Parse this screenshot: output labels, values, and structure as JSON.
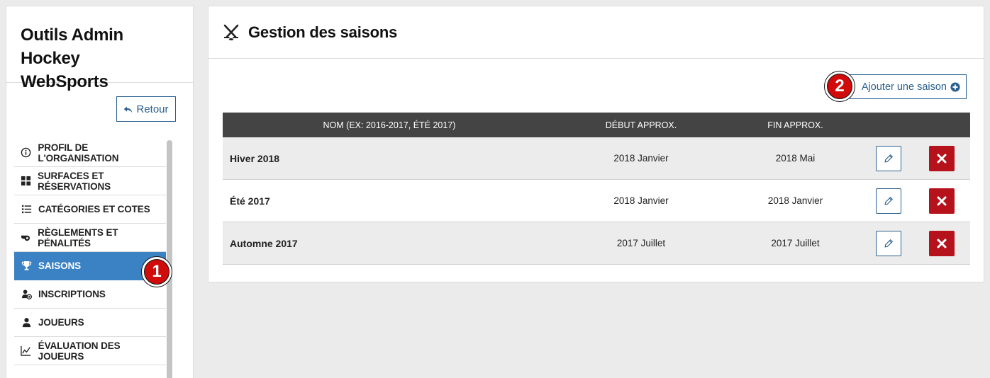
{
  "sidebar": {
    "title_line1": "Outils Admin Hockey",
    "title_line2": "WebSports",
    "back_label": "Retour",
    "back_icon": "reply-icon",
    "items": [
      {
        "label": "Profil de l'organisation",
        "icon": "info-circle-icon"
      },
      {
        "label": "Surfaces et réservations",
        "icon": "grid-icon"
      },
      {
        "label": "Catégories et cotes",
        "icon": "list-icon"
      },
      {
        "label": "Règlements et pénalités",
        "icon": "whistle-icon"
      },
      {
        "label": "Saisons",
        "icon": "trophy-icon",
        "active": true
      },
      {
        "label": "Inscriptions",
        "icon": "user-add-icon"
      },
      {
        "label": "Joueurs",
        "icon": "user-icon"
      },
      {
        "label": "Évaluation des joueurs",
        "icon": "line-chart-icon"
      }
    ]
  },
  "callouts": {
    "one": "1",
    "two": "2"
  },
  "main": {
    "title": "Gestion des saisons",
    "title_icon": "hockey-sticks-icon",
    "add_button_label": "Ajouter une saison",
    "add_button_icon": "plus-circle-icon",
    "table": {
      "headers": {
        "name": "Nom (ex: 2016-2017, été 2017)",
        "start": "Début approx.",
        "end": "Fin approx."
      },
      "rows": [
        {
          "name": "Hiver 2018",
          "start": "2018 Janvier",
          "end": "2018 Mai"
        },
        {
          "name": "Été 2017",
          "start": "2018 Janvier",
          "end": "2018 Janvier"
        },
        {
          "name": "Automne 2017",
          "start": "2017 Juillet",
          "end": "2017 Juillet"
        }
      ]
    }
  },
  "colors": {
    "accent": "#3a82c4",
    "button_border": "#2a5f8f",
    "danger": "#b5121b",
    "table_header": "#444444",
    "callout_red": "#d10a0a"
  }
}
